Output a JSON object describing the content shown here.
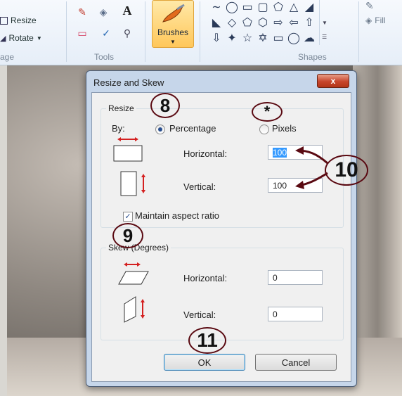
{
  "ribbon": {
    "image_group": {
      "resize_label": "Resize",
      "rotate_label": "Rotate",
      "group_label": "age"
    },
    "tools_group": {
      "group_label": "Tools"
    },
    "brushes": {
      "label": "Brushes"
    },
    "shapes_group": {
      "group_label": "Shapes"
    },
    "colors_group": {
      "fill_label": "Fill"
    }
  },
  "dialog": {
    "title": "Resize and Skew",
    "close_glyph": "x",
    "resize": {
      "legend": "Resize",
      "by_label": "By:",
      "percentage_label": "Percentage",
      "pixels_label": "Pixels",
      "selected_unit": "Percentage",
      "horizontal_label": "Horizontal:",
      "horizontal_value": "100",
      "vertical_label": "Vertical:",
      "vertical_value": "100",
      "maintain_aspect_label": "Maintain aspect ratio",
      "maintain_aspect_checked": true
    },
    "skew": {
      "legend": "Skew (Degrees)",
      "horizontal_label": "Horizontal:",
      "horizontal_value": "0",
      "vertical_label": "Vertical:",
      "vertical_value": "0"
    },
    "ok_label": "OK",
    "cancel_label": "Cancel"
  },
  "annotations": {
    "step_8": "8",
    "star": "*",
    "step_9": "9",
    "step_10": "10",
    "step_11": "11"
  },
  "colors": {
    "annotation_ring": "#5a0a12",
    "dialog_frame": "#c6d6ea",
    "close_button": "#c7452b",
    "selection": "#3399ff"
  }
}
